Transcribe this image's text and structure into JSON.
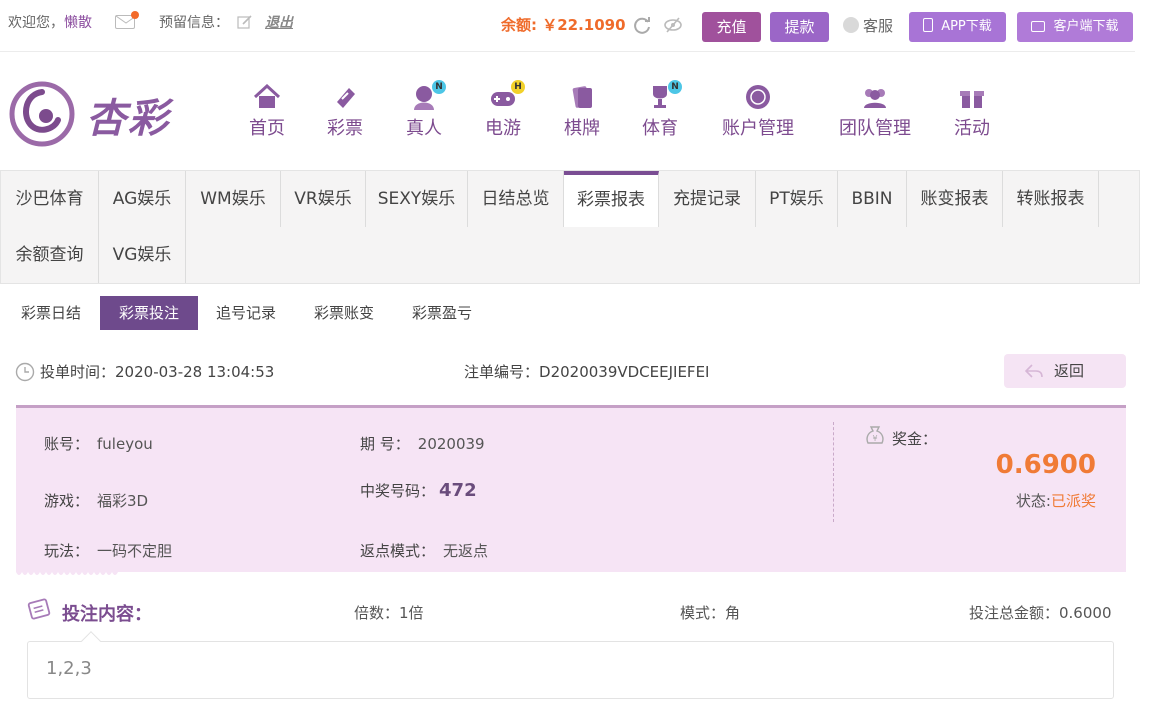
{
  "topbar": {
    "welcome": "欢迎您，",
    "username": "懒散",
    "reserve_label": "预留信息：",
    "logout": "退出",
    "balance": "余额: ￥22.1090",
    "recharge": "充值",
    "withdraw": "提款",
    "service": "客服",
    "app_download": "APP下载",
    "client_download": "客户端下载"
  },
  "logo": {
    "text": "杏彩"
  },
  "nav": [
    {
      "label": "首页",
      "icon": "home-icon"
    },
    {
      "label": "彩票",
      "icon": "lottery-icon"
    },
    {
      "label": "真人",
      "icon": "live-dealer-icon",
      "badge": "N"
    },
    {
      "label": "电游",
      "icon": "gamepad-icon",
      "badge": "H"
    },
    {
      "label": "棋牌",
      "icon": "cards-icon"
    },
    {
      "label": "体育",
      "icon": "trophy-icon",
      "badge": "N"
    },
    {
      "label": "账户管理",
      "icon": "account-icon"
    },
    {
      "label": "团队管理",
      "icon": "team-icon"
    },
    {
      "label": "活动",
      "icon": "gift-icon"
    }
  ],
  "tabs": [
    "沙巴体育",
    "AG娱乐",
    "WM娱乐",
    "VR娱乐",
    "SEXY娱乐",
    "日结总览",
    "彩票报表",
    "充提记录",
    "PT娱乐",
    "BBIN",
    "账变报表",
    "转账报表",
    "余额查询",
    "VG娱乐"
  ],
  "subtabs": [
    "彩票日结",
    "彩票投注",
    "追号记录",
    "彩票账变",
    "彩票盈亏"
  ],
  "order": {
    "time_label": "投单时间：",
    "time": "2020-03-28 13:04:53",
    "id_label": "注单编号：",
    "id": "D2020039VDCEEJIEFEI",
    "back": "返回"
  },
  "detail": {
    "account_label": "账号：",
    "account": "fuleyou",
    "game_label": "游戏：",
    "game": "福彩3D",
    "play_label": "玩法：",
    "play": "一码不定胆",
    "issue_label": "期 号：",
    "issue": "2020039",
    "winning_label": "中奖号码：",
    "winning": "472",
    "rebate_label": "返点模式：",
    "rebate": "无返点",
    "prize_label": "奖金：",
    "prize": "0.6900",
    "status_label": "状态:",
    "status": "已派奖"
  },
  "bet": {
    "title": "投注内容：",
    "multiplier": "倍数：1倍",
    "mode": "模式：角",
    "total": "投注总金额：0.6000",
    "content": "1,2,3"
  },
  "colors": {
    "accent": "#7a4d93",
    "orange": "#f07b36",
    "panel": "#f6e4f5"
  }
}
